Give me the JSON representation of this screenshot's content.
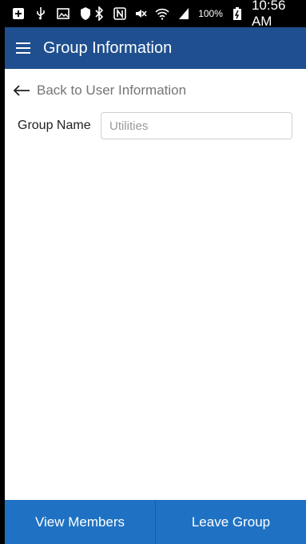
{
  "status_bar": {
    "battery_percent": "100%",
    "time": "10:56 AM",
    "icons": [
      "add-icon",
      "usb-icon",
      "image-icon",
      "shield-icon",
      "bluetooth-icon",
      "nfc-icon",
      "mute-icon",
      "wifi-icon",
      "signal-icon",
      "battery-icon"
    ]
  },
  "app_bar": {
    "title": "Group Information"
  },
  "back_link": {
    "label": "Back to User Information"
  },
  "form": {
    "group_name_label": "Group Name",
    "group_name_placeholder": "Utilities",
    "group_name_value": ""
  },
  "bottom_bar": {
    "view_members_label": "View Members",
    "leave_group_label": "Leave Group"
  },
  "colors": {
    "app_bar": "#1f4f8f",
    "bottom_bar": "#1f72c3",
    "status_bar": "#000000"
  }
}
